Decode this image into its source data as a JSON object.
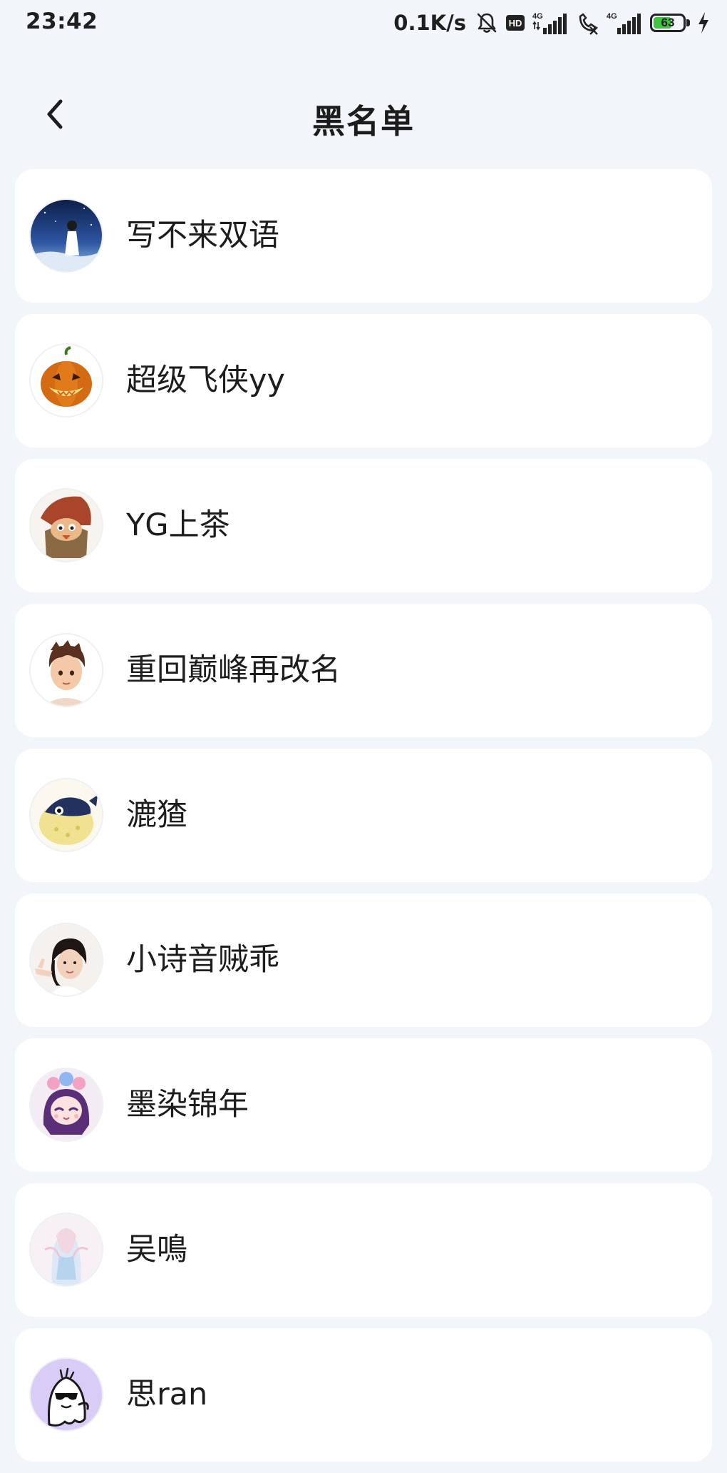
{
  "status_bar": {
    "time": "23:42",
    "net_speed": "0.1K/s",
    "hd_label": "HD",
    "network_label_1": "4G",
    "network_label_2": "4G",
    "battery_level": "63",
    "battery_fraction": 0.63,
    "icons": [
      "mute-bell-icon",
      "hd-icon",
      "signal-4g-icon",
      "call-blocked-icon",
      "signal-4g-icon",
      "battery-icon",
      "charging-icon"
    ]
  },
  "header": {
    "title": "黑名单",
    "back_icon": "chevron-left-icon"
  },
  "blacklist": {
    "items": [
      {
        "name": "写不来双语",
        "avatar": "night-sky-girl"
      },
      {
        "name": "超级飞侠yy",
        "avatar": "pumpkin"
      },
      {
        "name": "YG上茶",
        "avatar": "fox-character"
      },
      {
        "name": "重回巅峰再改名",
        "avatar": "boy-3d"
      },
      {
        "name": "漉猹",
        "avatar": "pufferfish"
      },
      {
        "name": "小诗音贼乖",
        "avatar": "girl-photo"
      },
      {
        "name": "墨染锦年",
        "avatar": "anime-girl"
      },
      {
        "name": "吴鳴",
        "avatar": "pastel-figure"
      },
      {
        "name": "思ran",
        "avatar": "cool-ghost"
      }
    ]
  },
  "colors": {
    "background": "#f2f5f9",
    "card": "#ffffff",
    "text": "#1d1d1d",
    "battery_green": "#3ec43e"
  }
}
